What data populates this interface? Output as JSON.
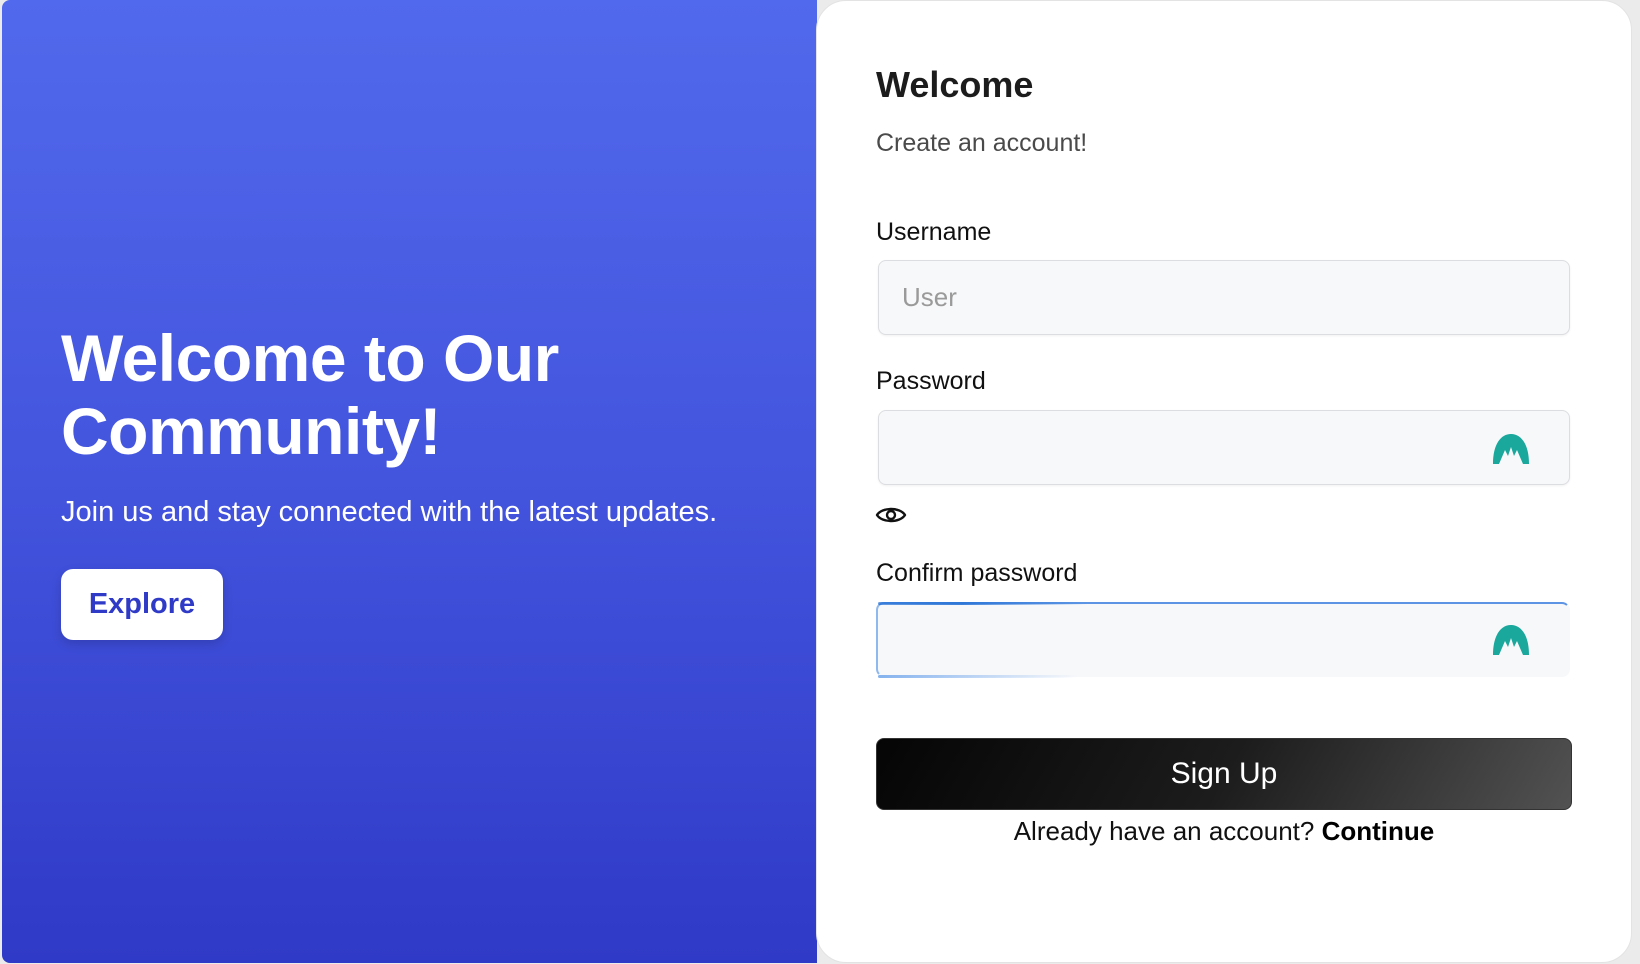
{
  "hero": {
    "title": "Welcome to Our Community!",
    "subtitle": "Join us and stay connected with the latest updates.",
    "cta_label": "Explore",
    "gradient_top": "#5169ec",
    "gradient_bottom": "#2f3ac6"
  },
  "form": {
    "title": "Welcome",
    "subtitle": "Create an account!",
    "fields": {
      "username": {
        "label": "Username",
        "placeholder": "User",
        "value": ""
      },
      "password": {
        "label": "Password",
        "placeholder": "",
        "value": "",
        "autofill_icon": "password-manager-icon",
        "toggle_icon": "eye-icon"
      },
      "confirm_password": {
        "label": "Confirm password",
        "placeholder": "",
        "value": "",
        "autofill_icon": "password-manager-icon",
        "focused": true
      }
    },
    "submit_label": "Sign Up",
    "login_prompt": "Already have an account?",
    "login_link": "Continue",
    "accent_color": "#1aa79c"
  }
}
